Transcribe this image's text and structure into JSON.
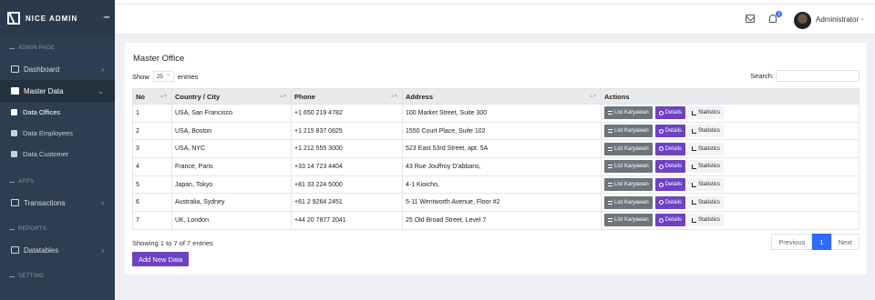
{
  "app": {
    "title": "NICE ADMIN"
  },
  "sidebar": {
    "sections": [
      {
        "title": "ADMIN PAGE"
      },
      {
        "title": "APPS"
      },
      {
        "title": "REPORTS"
      },
      {
        "title": "SETTING"
      }
    ],
    "items": {
      "dashboard": "Dashboard",
      "master_data": "Master Data",
      "data_offices": "Data Offices",
      "data_employees": "Data Employees",
      "data_customer": "Data Customer",
      "transactions": "Transactions",
      "datatables": "Datatables"
    }
  },
  "header": {
    "user_name": "Administrator",
    "notification_count": "3"
  },
  "card": {
    "title": "Master Office",
    "show_label": "Show",
    "page_size": "25",
    "entries_label": "entries",
    "search_label": "Search:"
  },
  "table": {
    "columns": [
      "No",
      "Country / City",
      "Phone",
      "Address",
      "Actions"
    ],
    "rows": [
      [
        "1",
        "USA, San Francisco",
        "+1 650 219 4782",
        "100 Market Street, Suite 300"
      ],
      [
        "2",
        "USA, Boston",
        "+1 215 837 0825",
        "1550 Court Place, Suite 102"
      ],
      [
        "3",
        "USA, NYC",
        "+1 212 555 3000",
        "523 East 53rd Street, apt. 5A"
      ],
      [
        "4",
        "France, Paris",
        "+33 14 723 4404",
        "43 Rue Jouffroy D'abbans,"
      ],
      [
        "5",
        "Japan, Tokyo",
        "+81 33 224 5000",
        "4-1 Kioicho,"
      ],
      [
        "6",
        "Australia, Sydney",
        "+61 2 9264 2451",
        "5-11 Wentworth Avenue, Floor #2"
      ],
      [
        "7",
        "UK, London",
        "+44 20 7877 2041",
        "25 Old Broad Street, Level 7"
      ]
    ],
    "actions": {
      "list": "List Karyawan",
      "details": "Details",
      "stats": "Statistics"
    }
  },
  "footer": {
    "info": "Showing 1 to 7 of 7 entries",
    "add_button": "Add New Data",
    "pagination": {
      "previous": "Previous",
      "current": "1",
      "next": "Next"
    }
  },
  "colors": {
    "sidebar": "#2c3e50",
    "primary": "#6f42c1",
    "secondary": "#6c757d",
    "page_active": "#2f6bff"
  }
}
